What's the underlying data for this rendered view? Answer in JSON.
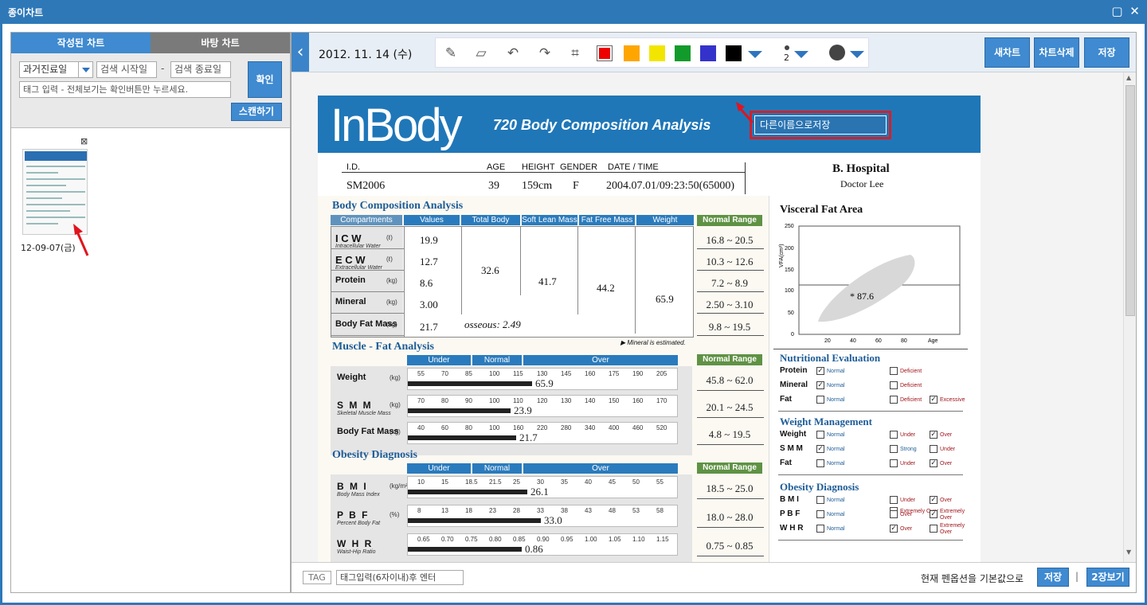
{
  "window": {
    "title": "종이차트"
  },
  "left": {
    "tabs": [
      "작성된 차트",
      "바탕 차트"
    ],
    "date_select": "과거진료일",
    "start_placeholder": "검색 시작일",
    "end_placeholder": "검색 종료일",
    "dash": "-",
    "tag_placeholder": "태그 입력 - 전체보기는 확인버튼만 누르세요.",
    "confirm": "확인",
    "scan": "스캔하기",
    "thumb_date": "12-09-07(금)",
    "thumb_close": "⊠"
  },
  "toolbar": {
    "back": "‹",
    "date": "2012. 11. 14 (수)",
    "colors": [
      "#ee0000",
      "#ffa500",
      "#f2e600",
      "#129b2b",
      "#3333cc",
      "#000000"
    ],
    "line_width": "2",
    "buttons": {
      "new": "새차트",
      "delete": "차트삭제",
      "save": "저장"
    }
  },
  "document": {
    "logo": "InBody",
    "subtitle": "720 Body Composition Analysis",
    "save_as": "다른이름으로저장",
    "info_headers": [
      "I.D.",
      "AGE",
      "HEIGHT",
      "GENDER",
      "DATE / TIME"
    ],
    "info_values": [
      "SM2006",
      "39",
      "159cm",
      "F",
      "2004.07.01/09:23:50(65000)"
    ],
    "hospital": "B. Hospital",
    "doctor": "Doctor Lee",
    "bca": {
      "title": "Body Composition Analysis",
      "headers": [
        "Compartments",
        "Values",
        "Total Body Water",
        "Soft Lean Mass",
        "Fat Free Mass",
        "Weight"
      ],
      "normal_header": "Normal Range",
      "rows": [
        {
          "name": "I C W",
          "unit": "(ℓ)",
          "sub": "Intracellular Water",
          "value": "19.9",
          "range": "16.8 ~ 20.5"
        },
        {
          "name": "E C W",
          "unit": "(ℓ)",
          "sub": "Extracellular Water",
          "value": "12.7",
          "range": "10.3 ~ 12.6"
        },
        {
          "name": "Protein",
          "unit": "(kg)",
          "sub": "",
          "value": "8.6",
          "range": "7.2 ~ 8.9"
        },
        {
          "name": "Mineral",
          "unit": "(kg)",
          "sub": "",
          "value": "3.00",
          "range": "2.50 ~ 3.10"
        },
        {
          "name": "Body Fat Mass",
          "unit": "(kg)",
          "sub": "",
          "value": "21.7",
          "range": "9.8 ~ 19.5"
        }
      ],
      "tbw": "32.6",
      "slm": "41.7",
      "ffm": "44.2",
      "weight": "65.9",
      "osseous": "osseous: 2.49",
      "mineral_note": "▶ Mineral is estimated."
    },
    "mfa": {
      "title": "Muscle - Fat Analysis",
      "bands": [
        "Under",
        "Normal",
        "Over"
      ],
      "normal_header": "Normal Range",
      "rows": [
        {
          "name": "Weight",
          "unit": "(kg)",
          "sub": "",
          "scale": [
            "55",
            "70",
            "85",
            "100",
            "115",
            "130",
            "145",
            "160",
            "175",
            "190",
            "205"
          ],
          "value": "65.9",
          "fill": 0.46,
          "range": "45.8 ~ 62.0"
        },
        {
          "name": "S M M",
          "unit": "(kg)",
          "sub": "Skeletal Muscle Mass",
          "scale": [
            "70",
            "80",
            "90",
            "100",
            "110",
            "120",
            "130",
            "140",
            "150",
            "160",
            "170"
          ],
          "value": "23.9",
          "fill": 0.38,
          "range": "20.1 ~ 24.5"
        },
        {
          "name": "Body Fat Mass",
          "unit": "(kg)",
          "sub": "",
          "scale": [
            "40",
            "60",
            "80",
            "100",
            "160",
            "220",
            "280",
            "340",
            "400",
            "460",
            "520"
          ],
          "value": "21.7",
          "fill": 0.4,
          "range": "4.8 ~ 19.5"
        }
      ]
    },
    "obesity": {
      "title": "Obesity Diagnosis",
      "bands": [
        "Under",
        "Normal",
        "Over"
      ],
      "normal_header": "Normal Range",
      "rows": [
        {
          "name": "B M I",
          "unit": "(kg/m²)",
          "sub": "Body Mass Index",
          "scale": [
            "10",
            "15",
            "18.5",
            "21.5",
            "25",
            "30",
            "35",
            "40",
            "45",
            "50",
            "55"
          ],
          "value": "26.1",
          "fill": 0.44,
          "range": "18.5 ~ 25.0"
        },
        {
          "name": "P B F",
          "unit": "(%)",
          "sub": "Percent Body Fat",
          "scale": [
            "8",
            "13",
            "18",
            "23",
            "28",
            "33",
            "38",
            "43",
            "48",
            "53",
            "58"
          ],
          "value": "33.0",
          "fill": 0.49,
          "range": "18.0 ~ 28.0"
        },
        {
          "name": "W H R",
          "unit": "",
          "sub": "Waist-Hip Ratio",
          "scale": [
            "0.65",
            "0.70",
            "0.75",
            "0.80",
            "0.85",
            "0.90",
            "0.95",
            "1.00",
            "1.05",
            "1.10",
            "1.15"
          ],
          "value": "0.86",
          "fill": 0.42,
          "range": "0.75 ~ 0.85"
        }
      ]
    },
    "vfa": {
      "title": "Visceral Fat Area",
      "ylabel": "VFA(cm²)",
      "yticks": [
        "250",
        "200",
        "150",
        "100",
        "50",
        "0"
      ],
      "xticks": [
        "20",
        "40",
        "60",
        "80",
        "Age"
      ],
      "value": "* 87.6"
    },
    "nutrition": {
      "title": "Nutritional Evaluation",
      "rows": [
        {
          "name": "Protein",
          "opts": [
            {
              "t": "Normal",
              "c": true
            },
            {
              "t": "Deficient",
              "c": false
            }
          ]
        },
        {
          "name": "Mineral",
          "opts": [
            {
              "t": "Normal",
              "c": true
            },
            {
              "t": "Deficient",
              "c": false
            }
          ]
        },
        {
          "name": "Fat",
          "opts": [
            {
              "t": "Normal",
              "c": false
            },
            {
              "t": "Deficient",
              "c": false
            },
            {
              "t": "Excessive",
              "c": true
            }
          ]
        }
      ]
    },
    "weight_mgmt": {
      "title": "Weight Management",
      "rows": [
        {
          "name": "Weight",
          "opts": [
            {
              "t": "Normal",
              "c": false
            },
            {
              "t": "Under",
              "c": false
            },
            {
              "t": "Over",
              "c": true
            }
          ]
        },
        {
          "name": "S M M",
          "opts": [
            {
              "t": "Normal",
              "c": true
            },
            {
              "t": "Strong",
              "c": false
            },
            {
              "t": "Under",
              "c": false
            }
          ]
        },
        {
          "name": "Fat",
          "opts": [
            {
              "t": "Normal",
              "c": false
            },
            {
              "t": "Under",
              "c": false
            },
            {
              "t": "Over",
              "c": true
            }
          ]
        }
      ]
    },
    "obesity_eval": {
      "title": "Obesity Diagnosis",
      "rows": [
        {
          "name": "B M I",
          "opts": [
            {
              "t": "Normal",
              "c": false
            },
            {
              "t": "Under",
              "c": false
            },
            {
              "t": "Over",
              "c": true
            }
          ],
          "extra": "Extremely Over"
        },
        {
          "name": "P B F",
          "opts": [
            {
              "t": "Normal",
              "c": false
            },
            {
              "t": "Over",
              "c": false
            },
            {
              "t": "Extremely Over",
              "c": true
            }
          ]
        },
        {
          "name": "W H R",
          "opts": [
            {
              "t": "Normal",
              "c": false
            },
            {
              "t": "Over",
              "c": true
            },
            {
              "t": "Extremely Over",
              "c": false
            }
          ]
        }
      ]
    }
  },
  "footer": {
    "tag_label": "TAG",
    "tag_placeholder": "태그입력(6자이내)후 엔터",
    "pen_note": "현재 펜옵션을 기본값으로",
    "save": "저장",
    "divider": "|",
    "view2": "2장보기"
  }
}
